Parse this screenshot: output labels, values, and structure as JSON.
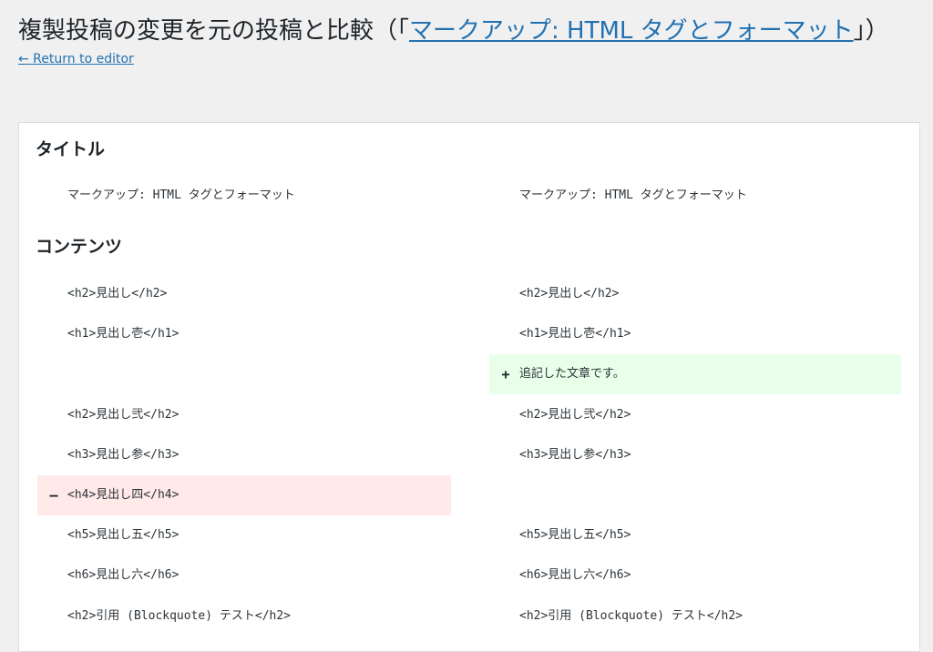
{
  "header": {
    "title_prefix": "複製投稿の変更を元の投稿と比較（「",
    "title_link": "マークアップ: HTML タグとフォーマット",
    "title_suffix": "」）",
    "return_link": "← Return to editor"
  },
  "sections": {
    "title_heading": "タイトル",
    "content_heading": "コンテンツ"
  },
  "title_row": {
    "left": "マークアップ: HTML タグとフォーマット",
    "right": "マークアップ: HTML タグとフォーマット"
  },
  "content_rows": [
    {
      "left": "<h2>見出し</h2>",
      "right": "<h2>見出し</h2>",
      "status": "unchanged"
    },
    {
      "left": "<h1>見出し壱</h1>",
      "right": "<h1>見出し壱</h1>",
      "status": "unchanged"
    },
    {
      "left": "",
      "right": "追記した文章です。",
      "status": "added",
      "sign": "+"
    },
    {
      "left": "<h2>見出し弐</h2>",
      "right": "<h2>見出し弐</h2>",
      "status": "unchanged"
    },
    {
      "left": "<h3>見出し参</h3>",
      "right": "<h3>見出し参</h3>",
      "status": "unchanged"
    },
    {
      "left": "<h4>見出し四</h4>",
      "right": "",
      "status": "deleted",
      "sign": "–"
    },
    {
      "left": "<h5>見出し五</h5>",
      "right": "<h5>見出し五</h5>",
      "status": "unchanged"
    },
    {
      "left": "<h6>見出し六</h6>",
      "right": "<h6>見出し六</h6>",
      "status": "unchanged"
    },
    {
      "left": "<h2>引用 (Blockquote) テスト</h2>",
      "right": "<h2>引用 (Blockquote) テスト</h2>",
      "status": "unchanged"
    }
  ],
  "colors": {
    "link": "#2271b1",
    "added_bg": "#e9ffe9",
    "deleted_bg": "#ffe9e9",
    "page_bg": "#f0f0f1"
  }
}
